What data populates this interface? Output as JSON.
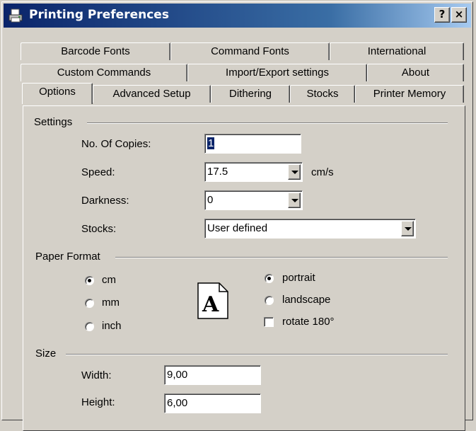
{
  "window": {
    "title": "Printing Preferences",
    "help_button": "?",
    "close_button": "×",
    "icon": "printer-icon"
  },
  "tabs": {
    "row1": [
      "Barcode Fonts",
      "Command Fonts",
      "International"
    ],
    "row2": [
      "Custom Commands",
      "Import/Export settings",
      "About"
    ],
    "row3": [
      "Options",
      "Advanced Setup",
      "Dithering",
      "Stocks",
      "Printer Memory"
    ],
    "active": "Options"
  },
  "settings": {
    "group_label": "Settings",
    "copies_label": "No. Of Copies:",
    "copies_value": "1",
    "speed_label": "Speed:",
    "speed_value": "17.5",
    "speed_unit": "cm/s",
    "darkness_label": "Darkness:",
    "darkness_value": "0",
    "stocks_label": "Stocks:",
    "stocks_value": "User defined"
  },
  "paper_format": {
    "group_label": "Paper Format",
    "units": [
      {
        "label": "cm",
        "selected": true
      },
      {
        "label": "mm",
        "selected": false
      },
      {
        "label": "inch",
        "selected": false
      }
    ],
    "orientation": [
      {
        "label": "portrait",
        "selected": true
      },
      {
        "label": "landscape",
        "selected": false
      }
    ],
    "rotate_label": "rotate 180°",
    "rotate_checked": false,
    "preview_letter": "A"
  },
  "size": {
    "group_label": "Size",
    "width_label": "Width:",
    "width_value": "9,00",
    "height_label": "Height:",
    "height_value": "6,00"
  }
}
